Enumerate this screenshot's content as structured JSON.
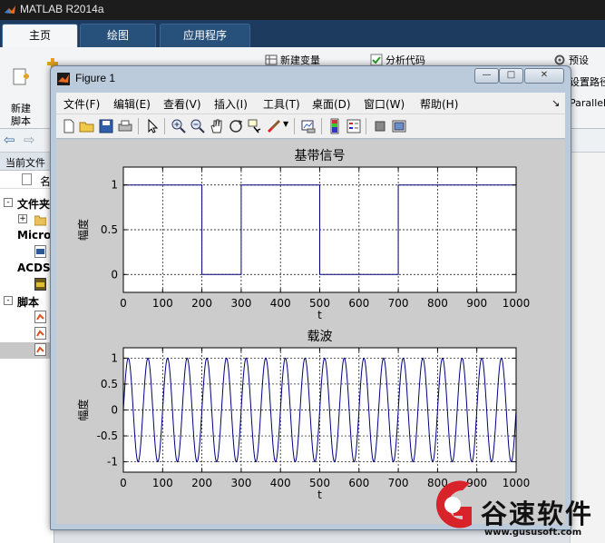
{
  "app": {
    "title": "MATLAB R2014a",
    "tabs": [
      "主页",
      "绘图",
      "应用程序"
    ],
    "ribbon": {
      "new_script": "新建\n脚本",
      "new_variable": "新建变量",
      "analyze_code": "分析代码",
      "preferences": "预设",
      "set_path": "设置路径",
      "parallel": "Parallel"
    },
    "current_folder_label": "当前文件",
    "name_column_label": "名",
    "tree": [
      {
        "label": "文件夹",
        "expand": "-"
      },
      {
        "label": "Micro",
        "expand": ""
      },
      {
        "label": "ACDS",
        "expand": ""
      },
      {
        "label": "脚本",
        "expand": "-"
      }
    ],
    "tree_child_expand": "+"
  },
  "figure": {
    "title": "Figure 1",
    "window_buttons": {
      "minimize": "—",
      "maximize": "□",
      "close": "✕"
    },
    "menu": [
      "文件(F)",
      "编辑(E)",
      "查看(V)",
      "插入(I)",
      "工具(T)",
      "桌面(D)",
      "窗口(W)",
      "帮助(H)"
    ],
    "toolbar_icons": [
      "new-figure-icon",
      "open-file-icon",
      "save-icon",
      "print-icon",
      "pointer-icon",
      "zoom-in-icon",
      "zoom-out-icon",
      "pan-hand-icon",
      "rotate-3d-icon",
      "data-cursor-icon",
      "brush-icon",
      "link-plot-icon",
      "colorbar-icon",
      "legend-icon",
      "hide-plot-tools-icon",
      "show-plot-tools-icon"
    ]
  },
  "chart_data": [
    {
      "type": "line",
      "title": "基带信号",
      "xlabel": "t",
      "ylabel": "幅度",
      "xlim": [
        0,
        1000
      ],
      "ylim": [
        -0.2,
        1.2
      ],
      "xticks": [
        0,
        100,
        200,
        300,
        400,
        500,
        600,
        700,
        800,
        900,
        1000
      ],
      "yticks": [
        0,
        0.5,
        1
      ],
      "grid": true,
      "line_color": "#00007f",
      "x": [
        0,
        200,
        200,
        300,
        300,
        500,
        500,
        700,
        700,
        1000,
        1000
      ],
      "y": [
        1,
        1,
        0,
        0,
        1,
        1,
        0,
        0,
        1,
        1,
        0
      ]
    },
    {
      "type": "line",
      "title": "载波",
      "xlabel": "t",
      "ylabel": "幅度",
      "xlim": [
        0,
        1000
      ],
      "ylim": [
        -1.2,
        1.2
      ],
      "xticks": [
        0,
        100,
        200,
        300,
        400,
        500,
        600,
        700,
        800,
        900,
        1000
      ],
      "yticks": [
        -1,
        -0.5,
        0,
        0.5,
        1
      ],
      "grid": true,
      "line_color": "#00007f",
      "function": "sin",
      "cycles": 20,
      "amplitude": 1
    }
  ],
  "watermark": {
    "name": "谷速软件",
    "url": "www.gususoft.com",
    "logo_color": "#d8232a"
  }
}
